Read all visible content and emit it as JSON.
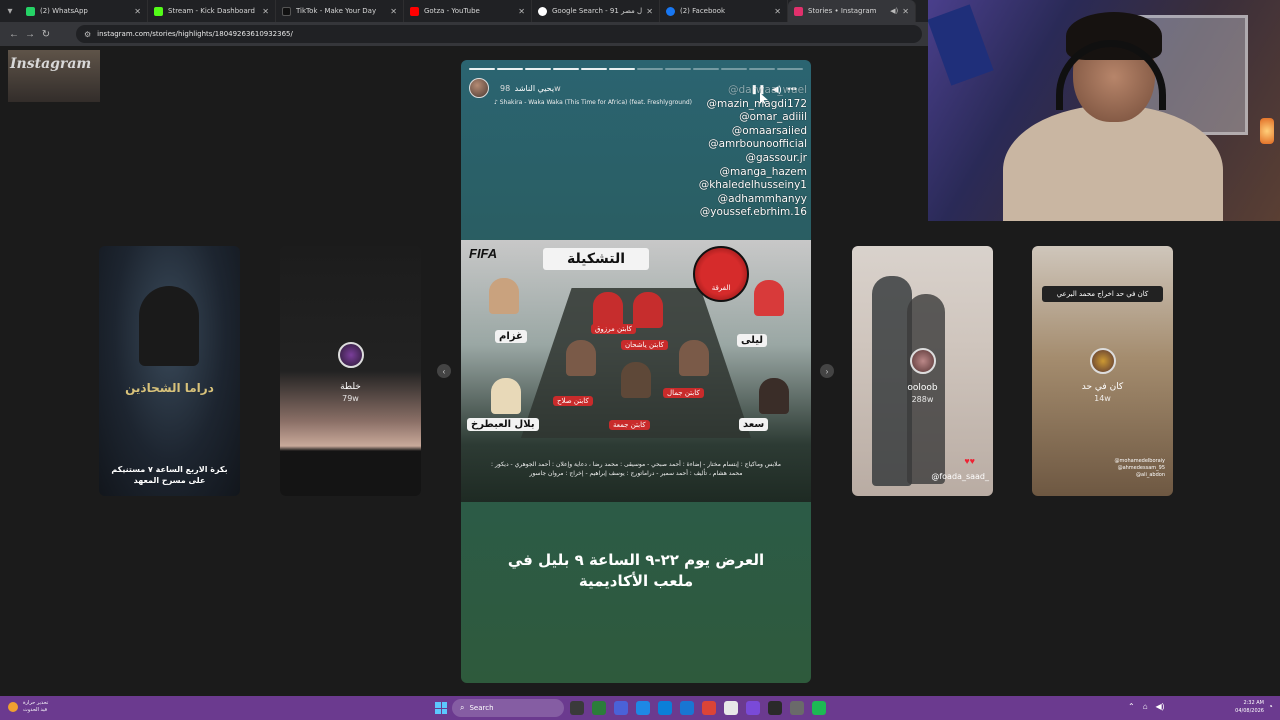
{
  "browser": {
    "tabs": [
      {
        "label": "(2) WhatsApp",
        "favicon_color": "#25d366",
        "active": false
      },
      {
        "label": "Stream - Kick Dashboard",
        "favicon_color": "#53fc18",
        "active": false
      },
      {
        "label": "TikTok - Make Your Day",
        "favicon_color": "#111111",
        "active": false
      },
      {
        "label": "Gotza - YouTube",
        "favicon_color": "#ff0000",
        "active": false
      },
      {
        "label": "Google Search - 91 زلزال مصر",
        "favicon_color": "#ffffff",
        "active": false
      },
      {
        "label": "(2) Facebook",
        "favicon_color": "#1877f2",
        "active": false
      },
      {
        "label": "Stories • Instagram",
        "favicon_color": "#e1306c",
        "active": true
      }
    ],
    "url": "instagram.com/stories/highlights/18049263610932365/"
  },
  "page": {
    "logo": "Instagram",
    "side_cards": [
      {
        "caption": "بكرة الاربع الساعة ٧ مستنيكم على مسرح المعهد",
        "poster_text": "دراما الشحاذين"
      },
      {
        "name": "خلطة",
        "time": "79w"
      },
      {
        "name": "ooloob",
        "time": "288w",
        "tag": "@foada_saad_"
      },
      {
        "name": "كان في حد",
        "time": "14w",
        "banner": "كان في حد اخراج محمد البرعي",
        "tags": [
          "@mohamedelboraiy",
          "@ahmedessam_95",
          "@ali_abdon"
        ]
      }
    ],
    "story": {
      "user": "يحيي الناشد",
      "time": "98w",
      "music": "Shakira - Waka Waka (This Time for Africa) (feat. Freshlyground)",
      "mentions": [
        "@darwaa_wael",
        "@mazin_magdi172",
        "@omar_adiiil",
        "@omaarsaiied",
        "@amrbounoofficial",
        "@gassour.jr",
        "@manga_hazem",
        "@khaledelhusseiny1",
        "@adhammhanyy",
        "@youssef.ebrhim.16"
      ],
      "poster": {
        "brand": "FIFA",
        "title": "التشكيلة",
        "badge": "الفرقة",
        "labels": {
          "p1": "كابتن مرزوق",
          "p2": "كابتن ياشحان",
          "p3": "كابتن صلاح",
          "p4": "كابتن جمال",
          "p5": "كابتن جمعة",
          "n1": "غزام",
          "n2": "ليلى",
          "n3": "بلال العبطرخ",
          "n4": "سعد"
        },
        "credits": "ملابس وماكياج : إبتسام مختار - إضاءة : أحمد صبحي - موسيقى : محمد رضا ، دعاية وإعلان : أحمد الجوهري - ديكور : محمد هشام ، تأليف : أحمد سمير - دراماتورج : يوسف إبراهيم - إخراج : مروان جاسور"
      },
      "caption": "العرض يوم ٢٢-٩ الساعة ٩ بليل في ملعب الأكاديمية"
    }
  },
  "taskbar": {
    "weather_line1": "تحذير حرارة",
    "weather_line2": "قيد الحدوث",
    "search_placeholder": "Search",
    "clock_time": "2:32 AM",
    "clock_date": "04/08/2026",
    "app_colors": [
      "#3a3a3a",
      "#2b7d3a",
      "#4a62d8",
      "#1e88e5",
      "#0b7fd8",
      "#1976d2",
      "#db4437",
      "#e8e8e8",
      "#7a4ad8",
      "#2a2a2a",
      "#6a6a6a",
      "#1db954"
    ]
  }
}
